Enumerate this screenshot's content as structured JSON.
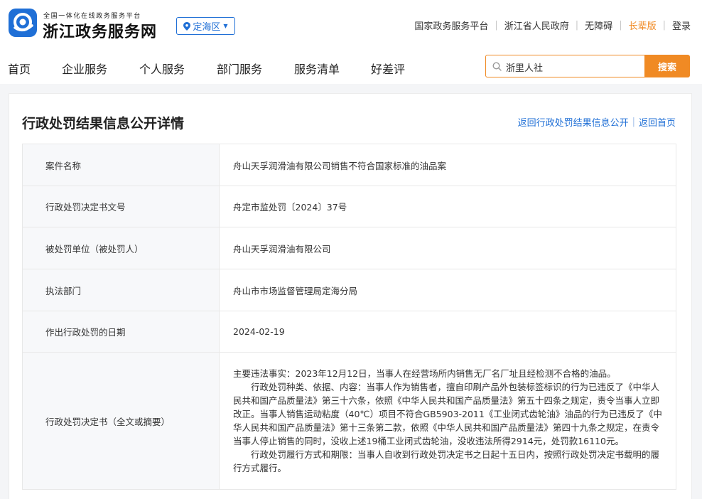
{
  "header": {
    "brand_small": "全国一体化在线政务服务平台",
    "brand_name": "浙江政务服务网",
    "region": "定海区",
    "top_links": [
      "国家政务服务平台",
      "浙江省人民政府",
      "无障碍",
      "长辈版",
      "登录"
    ],
    "nav": [
      "首页",
      "企业服务",
      "个人服务",
      "部门服务",
      "服务清单",
      "好差评"
    ],
    "search_value": "浙里人社",
    "search_button": "搜索"
  },
  "colors": {
    "brand_blue": "#1f6fd6",
    "accent_orange": "#f08a24"
  },
  "card": {
    "title": "行政处罚结果信息公开详情",
    "links": [
      "返回行政处罚结果信息公开",
      "返回首页"
    ],
    "rows": [
      {
        "label": "案件名称",
        "value": "舟山天孚润滑油有限公司销售不符合国家标准的油品案"
      },
      {
        "label": "行政处罚决定书文号",
        "value": "舟定市监处罚〔2024〕37号"
      },
      {
        "label": "被处罚单位（被处罚人）",
        "value": "舟山天孚润滑油有限公司"
      },
      {
        "label": "执法部门",
        "value": "舟山市市场监督管理局定海分局"
      },
      {
        "label": "作出行政处罚的日期",
        "value": "2024-02-19"
      }
    ],
    "decision": {
      "label": "行政处罚决定书（全文或摘要）",
      "paragraphs": [
        "主要违法事实：2023年12月12日，当事人在经营场所内销售无厂名厂址且经检测不合格的油品。",
        "行政处罚种类、依据、内容：当事人作为销售者，擅自印刷产品外包装标签标识的行为已违反了《中华人民共和国产品质量法》第三十六条，依照《中华人民共和国产品质量法》第五十四条之规定，责令当事人立即改正。当事人销售运动粘度（40℃）项目不符合GB5903-2011《工业闭式齿轮油》油品的行为已违反了《中华人民共和国产品质量法》第十三条第二款，依照《中华人民共和国产品质量法》第四十九条之规定，在责令当事人停止销售的同时，没收上述19桶工业闭式齿轮油，没收违法所得2914元，处罚款16110元。",
        "行政处罚履行方式和期限：当事人自收到行政处罚决定书之日起十五日内，按照行政处罚决定书载明的履行方式履行。"
      ]
    }
  }
}
